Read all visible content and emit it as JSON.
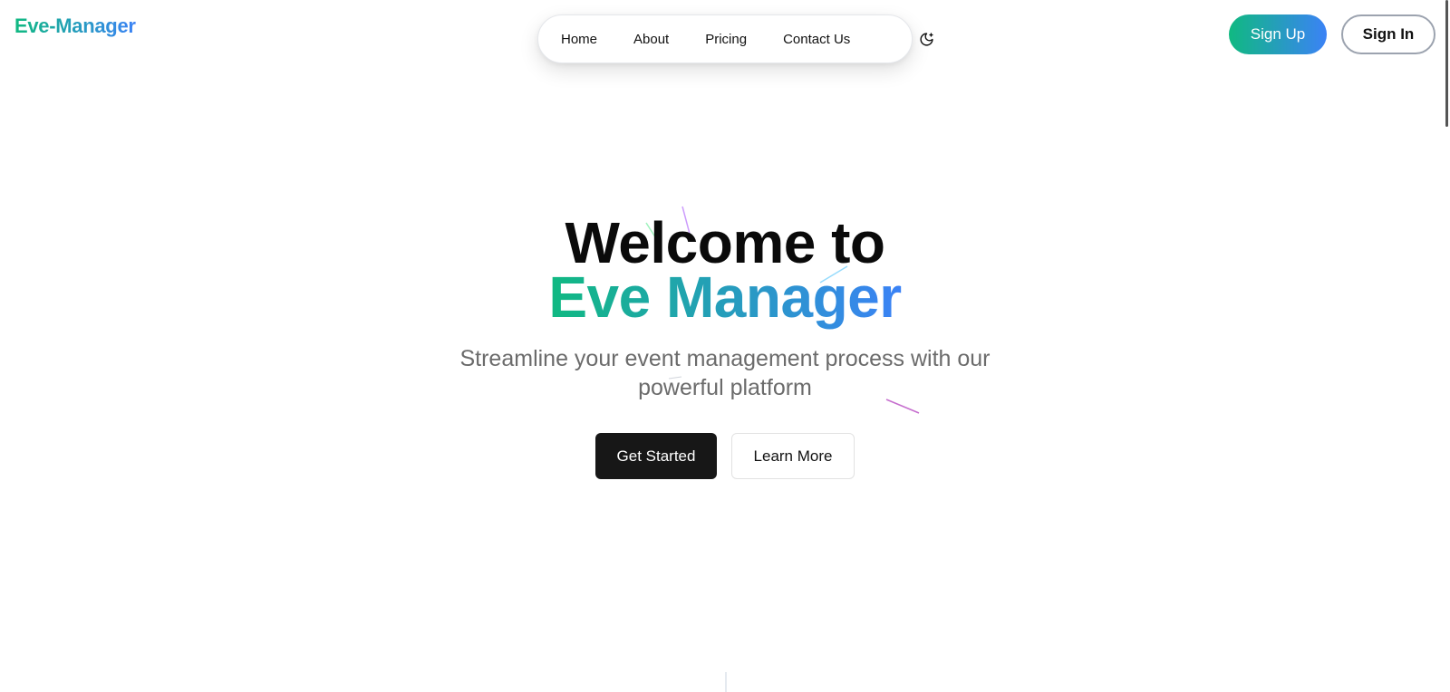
{
  "header": {
    "logo": "Eve-Manager",
    "nav": [
      {
        "label": "Home"
      },
      {
        "label": "About"
      },
      {
        "label": "Pricing"
      },
      {
        "label": "Contact Us"
      }
    ],
    "theme_toggle_icon": "moon-icon",
    "sign_up_label": "Sign Up",
    "sign_in_label": "Sign In"
  },
  "hero": {
    "title_line1": "Welcome to",
    "title_line2": "Eve Manager",
    "subtitle": "Streamline your event management process with our powerful platform",
    "primary_button": "Get Started",
    "secondary_button": "Learn More"
  },
  "colors": {
    "accent_start": "#10b981",
    "accent_end": "#3b82f6",
    "primary_button_bg": "#171717"
  }
}
